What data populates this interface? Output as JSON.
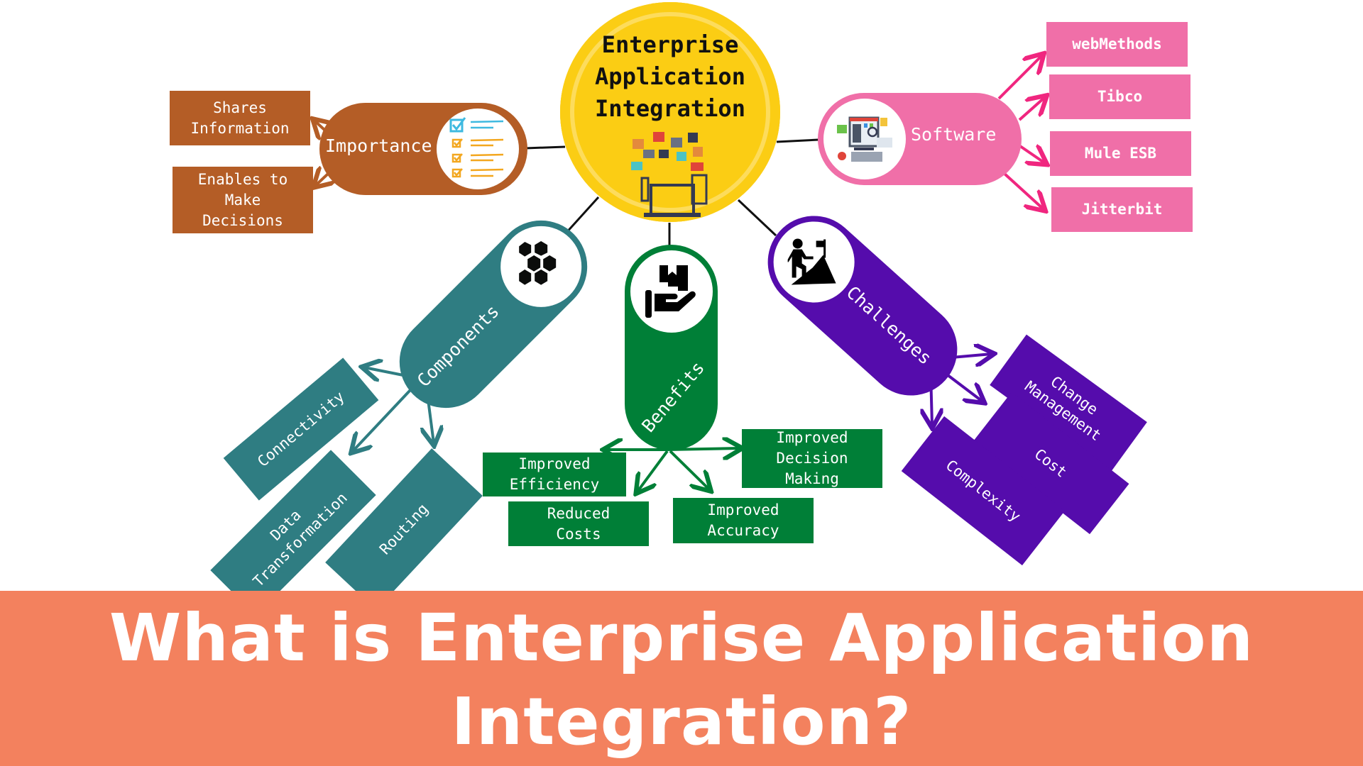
{
  "center": {
    "title": "Enterprise\nApplication\nIntegration",
    "icon": "devices-apps-icon",
    "color": "#fbcd14"
  },
  "branches": {
    "importance": {
      "label": "Importance",
      "icon": "checklist-icon",
      "color": "#b45d26",
      "children": [
        "Shares\nInformation",
        "Enables to\nMake\nDecisions"
      ]
    },
    "software": {
      "label": "Software",
      "icon": "computer-analysis-icon",
      "color": "#f06fa8",
      "arrow_color": "#f0267f",
      "children": [
        "webMethods",
        "Tibco",
        "Mule ESB",
        "Jitterbit"
      ]
    },
    "components": {
      "label": "Components",
      "icon": "hexagons-icon",
      "color": "#2f7d82",
      "children": [
        "Connectivity",
        "Data\nTransformation",
        "Routing"
      ]
    },
    "benefits": {
      "label": "Benefits",
      "icon": "hand-box-icon",
      "color": "#007f37",
      "children": [
        "Improved\nEfficiency",
        "Reduced\nCosts",
        "Improved\nAccuracy",
        "Improved\nDecision\nMaking"
      ]
    },
    "challenges": {
      "label": "Challenges",
      "icon": "climber-flag-icon",
      "color": "#550cac",
      "children": [
        "Change\nManagement",
        "Cost",
        "Complexity"
      ]
    }
  },
  "banner": {
    "title": "What is Enterprise Application\nIntegration?",
    "color": "#f3815e"
  }
}
